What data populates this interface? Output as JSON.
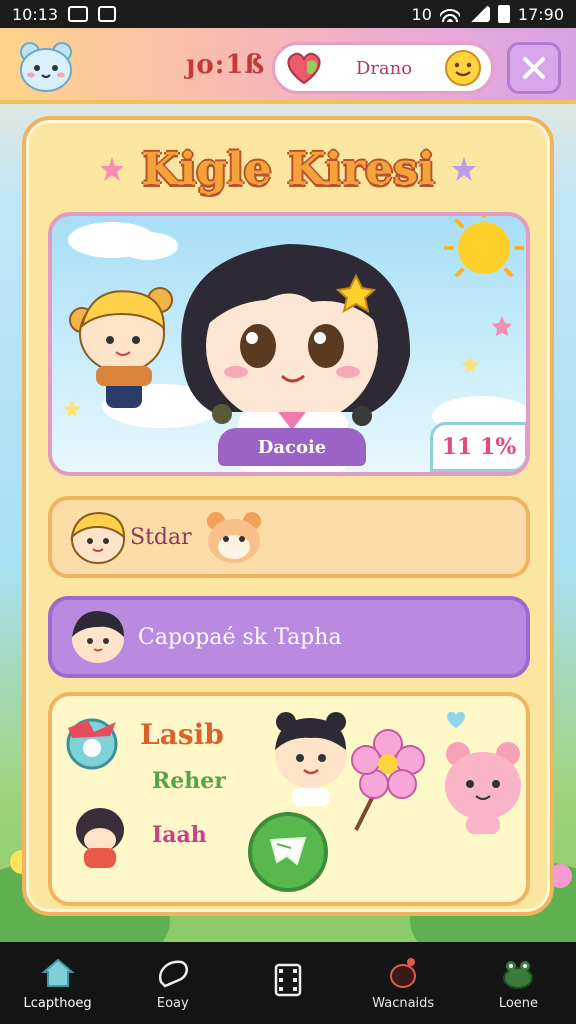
{
  "status_bar": {
    "time_left": "10:13",
    "time_right": "17:90",
    "signal_label": "10"
  },
  "header": {
    "score": "ȷo:1ß",
    "search_text": "Drano"
  },
  "card": {
    "title": "Kigle Kiresi",
    "hero_label": "Dacoie",
    "hero_percent": "11 1%",
    "row1_label": "Stdar",
    "row2_label": "Capopaé sk Tapha",
    "panel_line1": "Lasib",
    "panel_line2": "Reher",
    "panel_line3": "Iaah"
  },
  "nav": {
    "items": [
      {
        "label": "Lcapthoeg",
        "icon": "home-icon"
      },
      {
        "label": "Eoay",
        "icon": "chat-icon"
      },
      {
        "label": "",
        "icon": "film-icon"
      },
      {
        "label": "Wacnaids",
        "icon": "bug-icon"
      },
      {
        "label": "Loene",
        "icon": "frog-icon"
      }
    ]
  },
  "colors": {
    "accent_orange": "#f0b35f",
    "accent_purple": "#b98ae0",
    "accent_pink": "#e39ac4",
    "nav_bg": "#141414"
  }
}
